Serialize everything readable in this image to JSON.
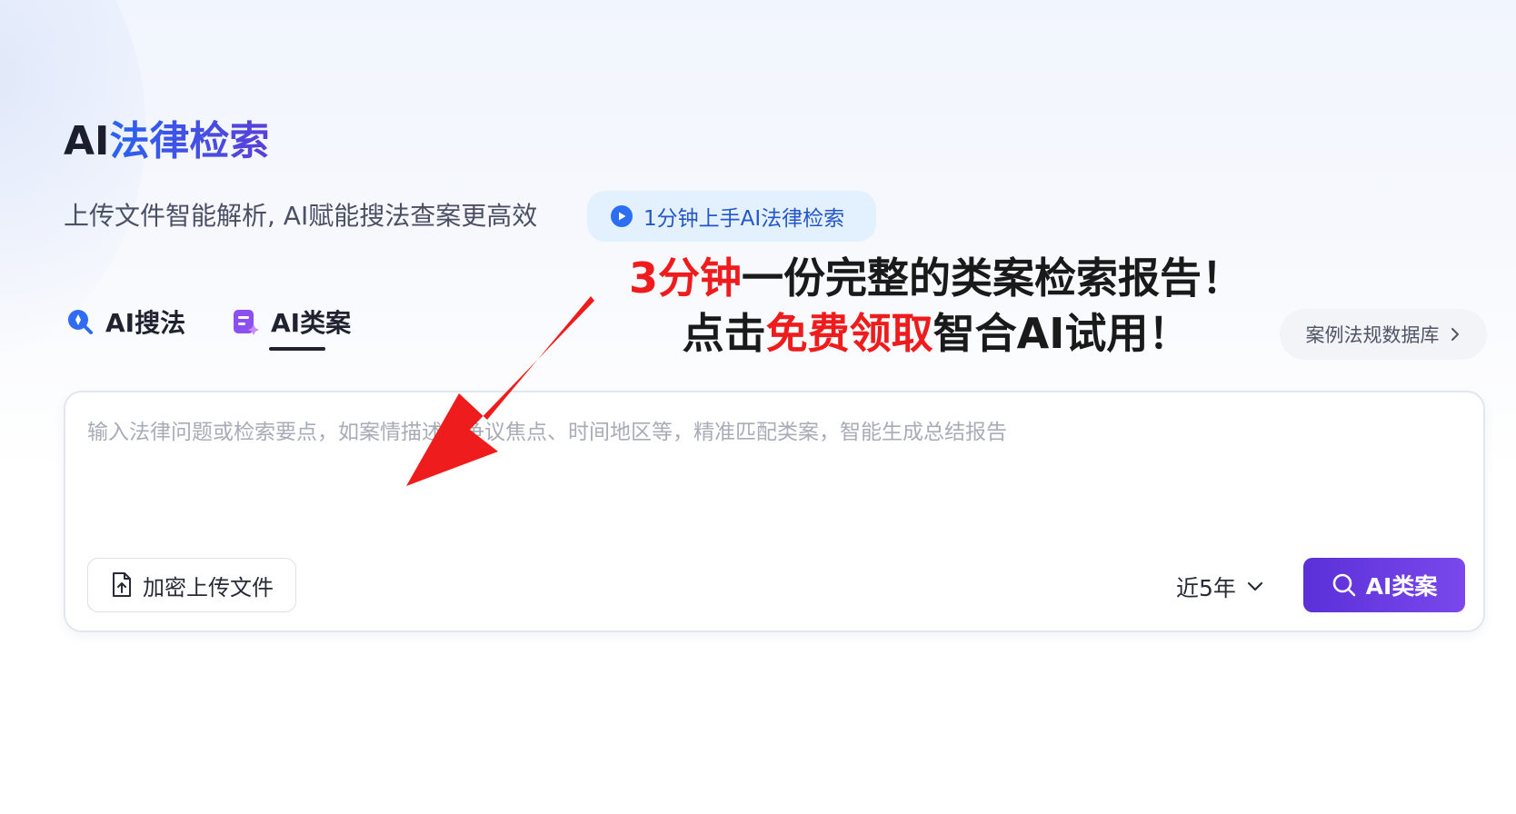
{
  "header": {
    "title_prefix": "AI",
    "title_main": "法律检索",
    "subtitle": "上传文件智能解析, AI赋能搜法查案更高效",
    "guide_link": "1分钟上手AI法律检索"
  },
  "promo": {
    "line1_highlight": "3分钟",
    "line1_rest": "一份完整的类案检索报告！",
    "line2_prefix": "点击",
    "line2_highlight": "免费领取",
    "line2_rest": "智合AI试用！"
  },
  "tabs": [
    {
      "label": "AI搜法",
      "active": false
    },
    {
      "label": "AI类案",
      "active": true
    }
  ],
  "db_link": {
    "label": "案例法规数据库"
  },
  "search": {
    "placeholder": "输入法律问题或检索要点，如案情描述、争议焦点、时间地区等，精准匹配类案，智能生成总结报告",
    "upload_label": "加密上传文件",
    "range_value": "近5年",
    "submit_label": "AI类案"
  },
  "colors": {
    "accent_blue": "#2f54eb",
    "accent_purple": "#6a3de6",
    "promo_red": "#ee1c1c"
  },
  "icons": {
    "guide": "play-circle-icon",
    "tab_law": "ai-law-search-icon",
    "tab_case": "ai-case-icon",
    "db_link": "chevron-right-icon",
    "upload": "file-upload-icon",
    "range": "chevron-down-icon",
    "submit": "search-icon"
  }
}
